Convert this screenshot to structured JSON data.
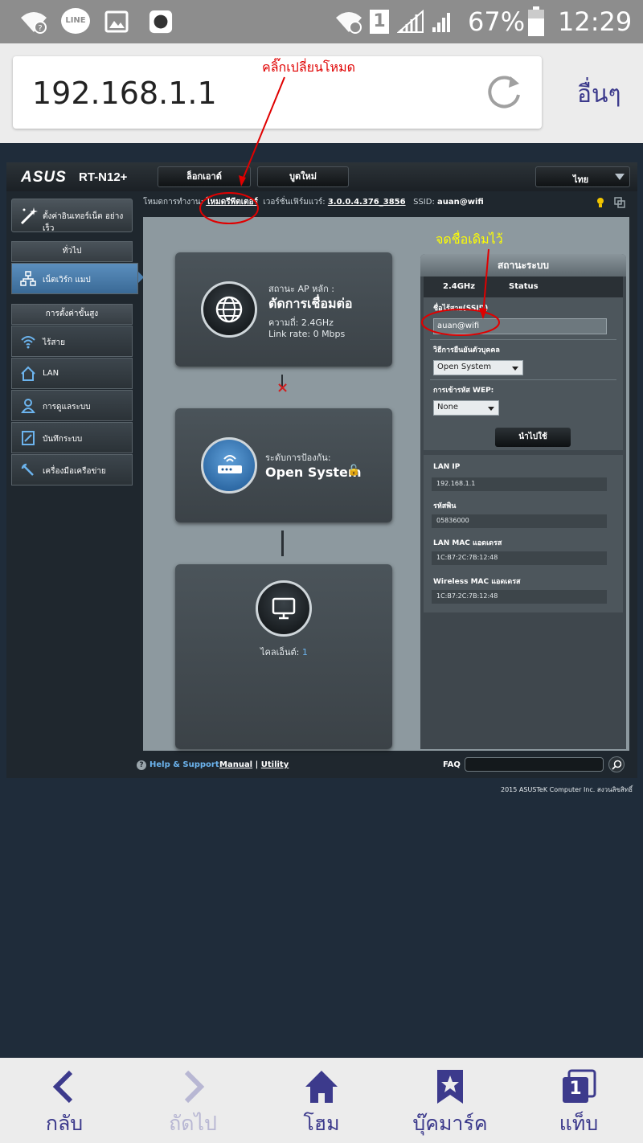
{
  "status_bar": {
    "battery": "67%",
    "time": "12:29",
    "sim": "1",
    "app_label": "LINE"
  },
  "browser": {
    "url": "192.168.1.1",
    "more_label": "อื่นๆ"
  },
  "annotations": {
    "mode_note": "คลิ๊กเปลี่ยนโหมด",
    "ssid_note": "จดชื่อเดิมไว้"
  },
  "router": {
    "logo": "ASUS",
    "model": "RT-N12+",
    "logout": "ล็อกเอาต์",
    "reboot": "บูตใหม่",
    "language": "ไทย",
    "info": {
      "mode_label": "โหมดการทำงาน:",
      "mode_value": "โหมดรีพีตเตอร์",
      "fw_label": "เวอร์ชั่นเฟิร์มแวร์:",
      "fw_value": "3.0.0.4.376_3856",
      "ssid_label": "SSID:",
      "ssid_value": "auan@wifi"
    },
    "quick_setup": "ตั้งค่าอินเทอร์เน็ต อย่างเร็ว",
    "nav": {
      "general_header": "ทั่วไป",
      "network_map": "เน็ตเวิร์ก แมป",
      "advanced_header": "การตั้งค่าขั้นสูง",
      "items": [
        "ไร้สาย",
        "LAN",
        "การดูแลระบบ",
        "บันทึกระบบ",
        "เครื่องมือเครือข่าย"
      ]
    },
    "ap_card": {
      "status_label": "สถานะ AP หลัก :",
      "status_value": "ตัดการเชื่อมต่อ",
      "freq": "ความถี่: 2.4GHz",
      "linkrate": "Link rate: 0 Mbps"
    },
    "sec_card": {
      "label": "ระดับการป้องกัน:",
      "value": "Open System"
    },
    "client_card": {
      "label": "ไคลเอ็นต์:",
      "count": "1"
    },
    "status_panel": {
      "title": "สถานะระบบ",
      "tab1": "2.4GHz",
      "tab2": "Status",
      "ssid_label": "ชื่อไร้สาย(SSID)",
      "ssid_value": "auan@wifi",
      "auth_label": "วิธีการยืนยันตัวบุคคล",
      "auth_value": "Open System",
      "wep_label": "การเข้ารหัส WEP:",
      "wep_value": "None",
      "apply": "นำไปใช้",
      "lan_ip_label": "LAN IP",
      "lan_ip": "192.168.1.1",
      "pin_label": "รหัสพิน",
      "pin": "05836000",
      "lan_mac_label": "LAN MAC แอดเดรส",
      "lan_mac": "1C:B7:2C:7B:12:48",
      "wl_mac_label": "Wireless MAC แอดเดรส",
      "wl_mac": "1C:B7:2C:7B:12:48"
    },
    "footer": {
      "help": "Help & Support",
      "manual": "Manual",
      "sep": "|",
      "utility": "Utility",
      "faq": "FAQ"
    },
    "copyright": "2015 ASUSTeK Computer Inc. สงวนลิขสิทธิ์"
  },
  "bottom_nav": {
    "back": "กลับ",
    "forward": "ถัดไป",
    "home": "โฮม",
    "bookmarks": "บุ๊คมาร์ค",
    "tabs": "แท็บ",
    "tab_count": "1"
  },
  "colors": {
    "accent": "#3c3a8c",
    "annotation": "#e00000",
    "annotation_alt": "#ffff00"
  }
}
